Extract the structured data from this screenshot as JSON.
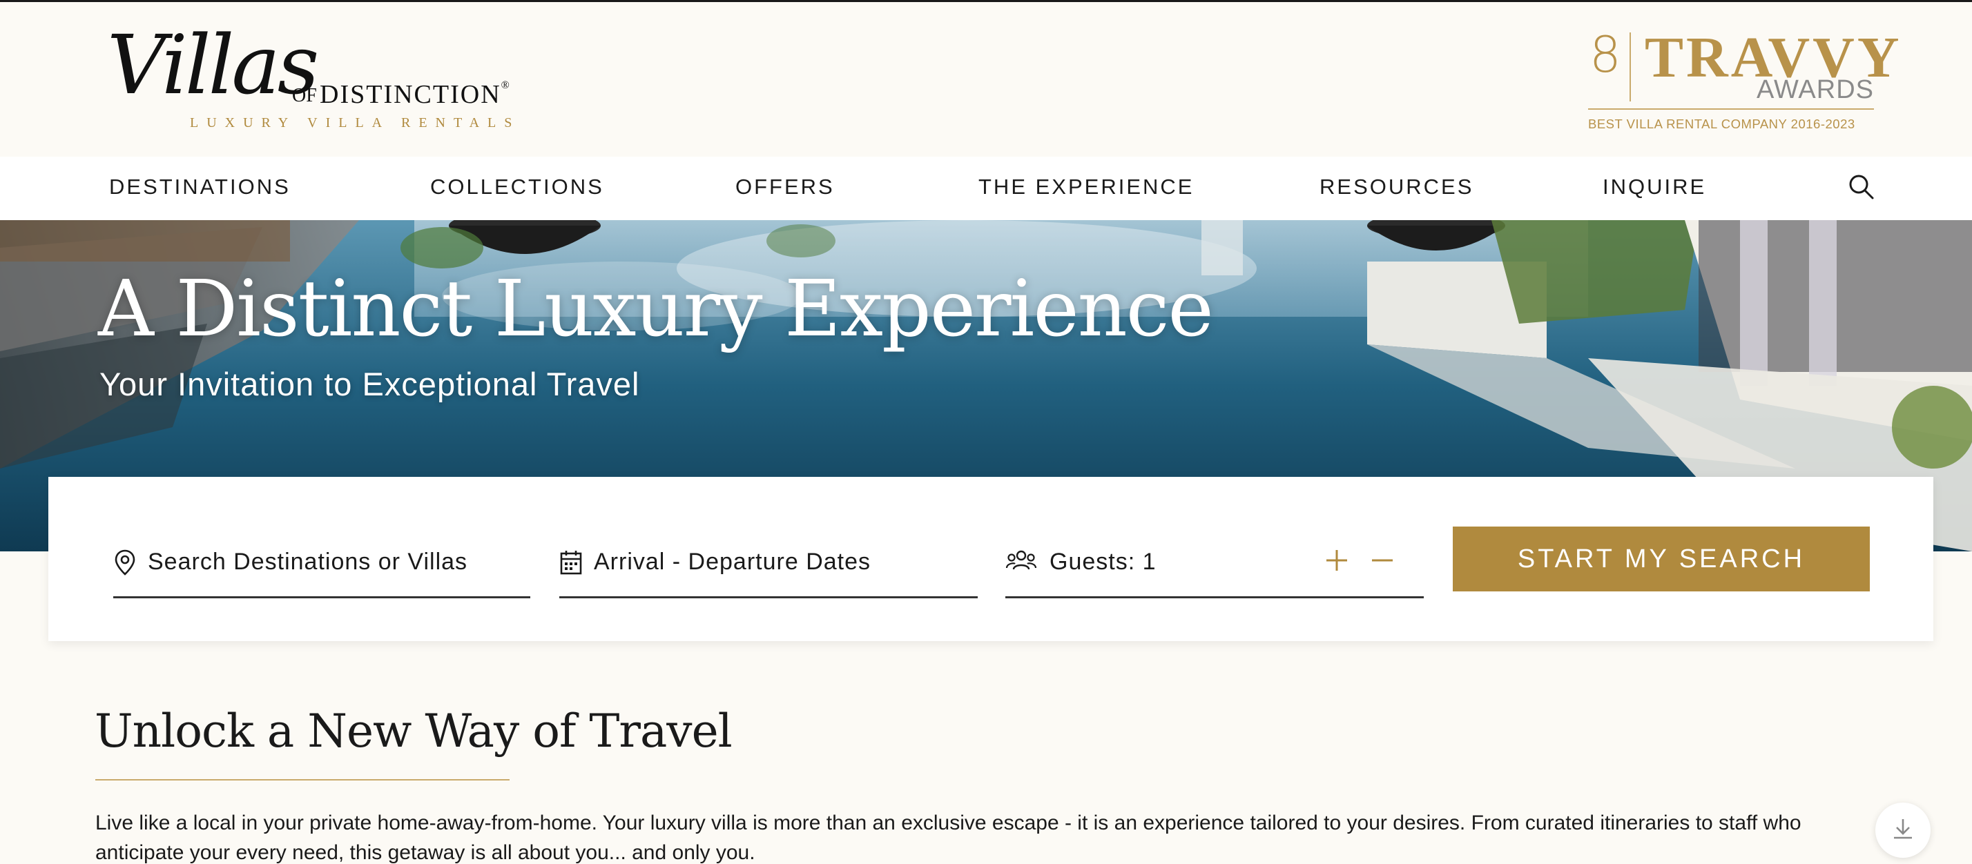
{
  "logo": {
    "villas": "Villas",
    "of": "OF",
    "distinction": "DISTINCTION",
    "registered": "®",
    "tagline": "LUXURY VILLA RENTALS"
  },
  "award": {
    "count": "8",
    "name": "TRAVVY",
    "awards": "AWARDS",
    "subtitle": "BEST VILLA RENTAL COMPANY 2016-2023"
  },
  "nav": {
    "items": [
      "DESTINATIONS",
      "COLLECTIONS",
      "OFFERS",
      "THE EXPERIENCE",
      "RESOURCES",
      "INQUIRE"
    ],
    "search_icon": "search-icon"
  },
  "hero": {
    "title": "A Distinct Luxury Experience",
    "subtitle": "Your Invitation to Exceptional Travel"
  },
  "search": {
    "destination_placeholder": "Search Destinations or Villas",
    "dates_placeholder": "Arrival - Departure Dates",
    "guests_label": "Guests: 1",
    "button_label": "START MY SEARCH"
  },
  "intro": {
    "heading": "Unlock a New Way of Travel",
    "body": "Live like a local in your private home-away-from-home. Your luxury villa is more than an exclusive escape - it is an experience tailored to your desires. From curated itineraries to staff who anticipate your every need, this getaway is all about you... and only you."
  },
  "colors": {
    "accent_gold": "#b08a3e",
    "background": "#fcfaf5",
    "text": "#1a1a1a"
  }
}
